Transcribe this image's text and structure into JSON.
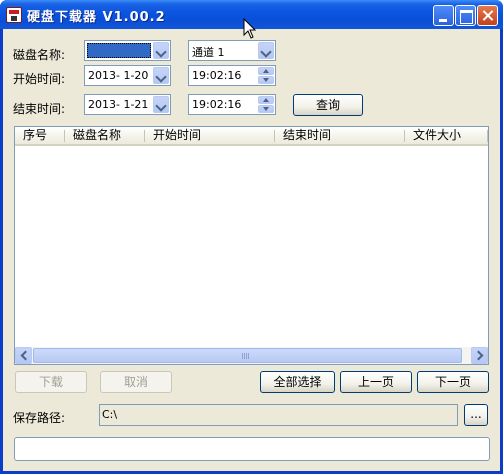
{
  "window": {
    "title": "硬盘下载器 V1.00.2"
  },
  "form": {
    "disk_name_label": "磁盘名称:",
    "disk_name_value": "",
    "channel_value": "通道 1",
    "start_time_label": "开始时间:",
    "start_date": "2013- 1-20",
    "start_time": "19:02:16",
    "end_time_label": "结束时间:",
    "end_date": "2013- 1-21",
    "end_time": "19:02:16",
    "query_button": "查询"
  },
  "list": {
    "columns": [
      "序号",
      "磁盘名称",
      "开始时间",
      "结束时间",
      "文件大小"
    ],
    "rows": []
  },
  "actions": {
    "download": "下载",
    "cancel": "取消",
    "select_all": "全部选择",
    "prev_page": "上一页",
    "next_page": "下一页"
  },
  "save": {
    "label": "保存路径:",
    "path": "C:\\",
    "browse": "..."
  },
  "colors": {
    "title_bar": "#0a54e0",
    "client_bg": "#ece9d8",
    "selection": "#316ac5"
  }
}
